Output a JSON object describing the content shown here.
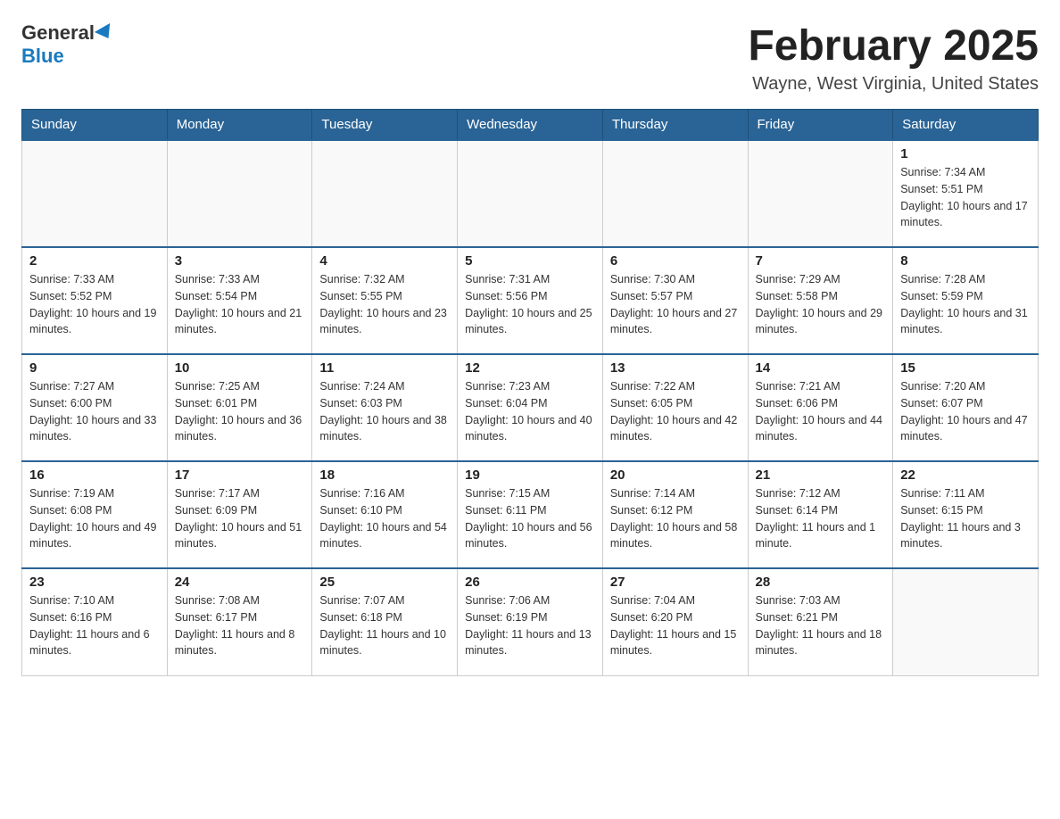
{
  "logo": {
    "general": "General",
    "blue": "Blue"
  },
  "title": "February 2025",
  "subtitle": "Wayne, West Virginia, United States",
  "days_of_week": [
    "Sunday",
    "Monday",
    "Tuesday",
    "Wednesday",
    "Thursday",
    "Friday",
    "Saturday"
  ],
  "weeks": [
    [
      {
        "day": "",
        "info": ""
      },
      {
        "day": "",
        "info": ""
      },
      {
        "day": "",
        "info": ""
      },
      {
        "day": "",
        "info": ""
      },
      {
        "day": "",
        "info": ""
      },
      {
        "day": "",
        "info": ""
      },
      {
        "day": "1",
        "info": "Sunrise: 7:34 AM\nSunset: 5:51 PM\nDaylight: 10 hours and 17 minutes."
      }
    ],
    [
      {
        "day": "2",
        "info": "Sunrise: 7:33 AM\nSunset: 5:52 PM\nDaylight: 10 hours and 19 minutes."
      },
      {
        "day": "3",
        "info": "Sunrise: 7:33 AM\nSunset: 5:54 PM\nDaylight: 10 hours and 21 minutes."
      },
      {
        "day": "4",
        "info": "Sunrise: 7:32 AM\nSunset: 5:55 PM\nDaylight: 10 hours and 23 minutes."
      },
      {
        "day": "5",
        "info": "Sunrise: 7:31 AM\nSunset: 5:56 PM\nDaylight: 10 hours and 25 minutes."
      },
      {
        "day": "6",
        "info": "Sunrise: 7:30 AM\nSunset: 5:57 PM\nDaylight: 10 hours and 27 minutes."
      },
      {
        "day": "7",
        "info": "Sunrise: 7:29 AM\nSunset: 5:58 PM\nDaylight: 10 hours and 29 minutes."
      },
      {
        "day": "8",
        "info": "Sunrise: 7:28 AM\nSunset: 5:59 PM\nDaylight: 10 hours and 31 minutes."
      }
    ],
    [
      {
        "day": "9",
        "info": "Sunrise: 7:27 AM\nSunset: 6:00 PM\nDaylight: 10 hours and 33 minutes."
      },
      {
        "day": "10",
        "info": "Sunrise: 7:25 AM\nSunset: 6:01 PM\nDaylight: 10 hours and 36 minutes."
      },
      {
        "day": "11",
        "info": "Sunrise: 7:24 AM\nSunset: 6:03 PM\nDaylight: 10 hours and 38 minutes."
      },
      {
        "day": "12",
        "info": "Sunrise: 7:23 AM\nSunset: 6:04 PM\nDaylight: 10 hours and 40 minutes."
      },
      {
        "day": "13",
        "info": "Sunrise: 7:22 AM\nSunset: 6:05 PM\nDaylight: 10 hours and 42 minutes."
      },
      {
        "day": "14",
        "info": "Sunrise: 7:21 AM\nSunset: 6:06 PM\nDaylight: 10 hours and 44 minutes."
      },
      {
        "day": "15",
        "info": "Sunrise: 7:20 AM\nSunset: 6:07 PM\nDaylight: 10 hours and 47 minutes."
      }
    ],
    [
      {
        "day": "16",
        "info": "Sunrise: 7:19 AM\nSunset: 6:08 PM\nDaylight: 10 hours and 49 minutes."
      },
      {
        "day": "17",
        "info": "Sunrise: 7:17 AM\nSunset: 6:09 PM\nDaylight: 10 hours and 51 minutes."
      },
      {
        "day": "18",
        "info": "Sunrise: 7:16 AM\nSunset: 6:10 PM\nDaylight: 10 hours and 54 minutes."
      },
      {
        "day": "19",
        "info": "Sunrise: 7:15 AM\nSunset: 6:11 PM\nDaylight: 10 hours and 56 minutes."
      },
      {
        "day": "20",
        "info": "Sunrise: 7:14 AM\nSunset: 6:12 PM\nDaylight: 10 hours and 58 minutes."
      },
      {
        "day": "21",
        "info": "Sunrise: 7:12 AM\nSunset: 6:14 PM\nDaylight: 11 hours and 1 minute."
      },
      {
        "day": "22",
        "info": "Sunrise: 7:11 AM\nSunset: 6:15 PM\nDaylight: 11 hours and 3 minutes."
      }
    ],
    [
      {
        "day": "23",
        "info": "Sunrise: 7:10 AM\nSunset: 6:16 PM\nDaylight: 11 hours and 6 minutes."
      },
      {
        "day": "24",
        "info": "Sunrise: 7:08 AM\nSunset: 6:17 PM\nDaylight: 11 hours and 8 minutes."
      },
      {
        "day": "25",
        "info": "Sunrise: 7:07 AM\nSunset: 6:18 PM\nDaylight: 11 hours and 10 minutes."
      },
      {
        "day": "26",
        "info": "Sunrise: 7:06 AM\nSunset: 6:19 PM\nDaylight: 11 hours and 13 minutes."
      },
      {
        "day": "27",
        "info": "Sunrise: 7:04 AM\nSunset: 6:20 PM\nDaylight: 11 hours and 15 minutes."
      },
      {
        "day": "28",
        "info": "Sunrise: 7:03 AM\nSunset: 6:21 PM\nDaylight: 11 hours and 18 minutes."
      },
      {
        "day": "",
        "info": ""
      }
    ]
  ]
}
